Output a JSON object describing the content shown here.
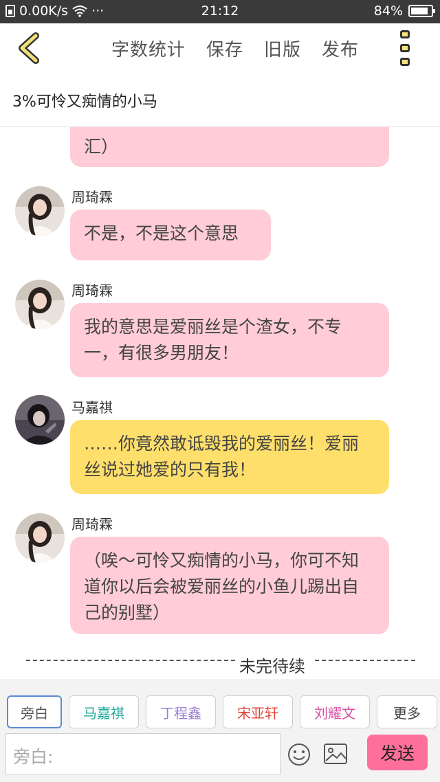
{
  "status_bar": {
    "speed": "0.00K/s",
    "wifi": "wifi-icon",
    "more": "···",
    "time": "21:12",
    "battery": "84%",
    "battery_level": 0.84
  },
  "topbar": {
    "menu": [
      "字数统计",
      "保存",
      "旧版",
      "发布"
    ]
  },
  "doc_title": "3%可怜又痴情的小马",
  "messages": [
    {
      "speaker": "",
      "text": "汇）",
      "color": "pink"
    },
    {
      "speaker": "周琦霖",
      "text": "不是，不是这个意思",
      "color": "pink"
    },
    {
      "speaker": "周琦霖",
      "text": "我的意思是爱丽丝是个渣女，不专一，有很多男朋友！",
      "color": "pink"
    },
    {
      "speaker": "马嘉祺",
      "text": "……你竟然敢诋毁我的爱丽丝！爱丽丝说过她爱的只有我！",
      "color": "yellow"
    },
    {
      "speaker": "周琦霖",
      "text": "（唉～可怜又痴情的小马，你可不知道你以后会被爱丽丝的小鱼儿踢出自己的别墅）",
      "color": "pink"
    }
  ],
  "to_be_continued": "未完待续",
  "roles": [
    {
      "label": "旁白",
      "color": "#555555"
    },
    {
      "label": "马嘉祺",
      "color": "#1eaa9a"
    },
    {
      "label": "丁程鑫",
      "color": "#9a7ed3"
    },
    {
      "label": "宋亚轩",
      "color": "#e0443a"
    },
    {
      "label": "刘耀文",
      "color": "#d94fa3"
    },
    {
      "label": "更多",
      "color": "#444444"
    }
  ],
  "composer": {
    "placeholder": "旁白:",
    "send_label": "发送"
  },
  "colors": {
    "bubble_pink": "#ffccd7",
    "bubble_yellow": "#ffdf6b",
    "send_button": "#ff6f9b",
    "back_arrow": "#f1e07a"
  }
}
